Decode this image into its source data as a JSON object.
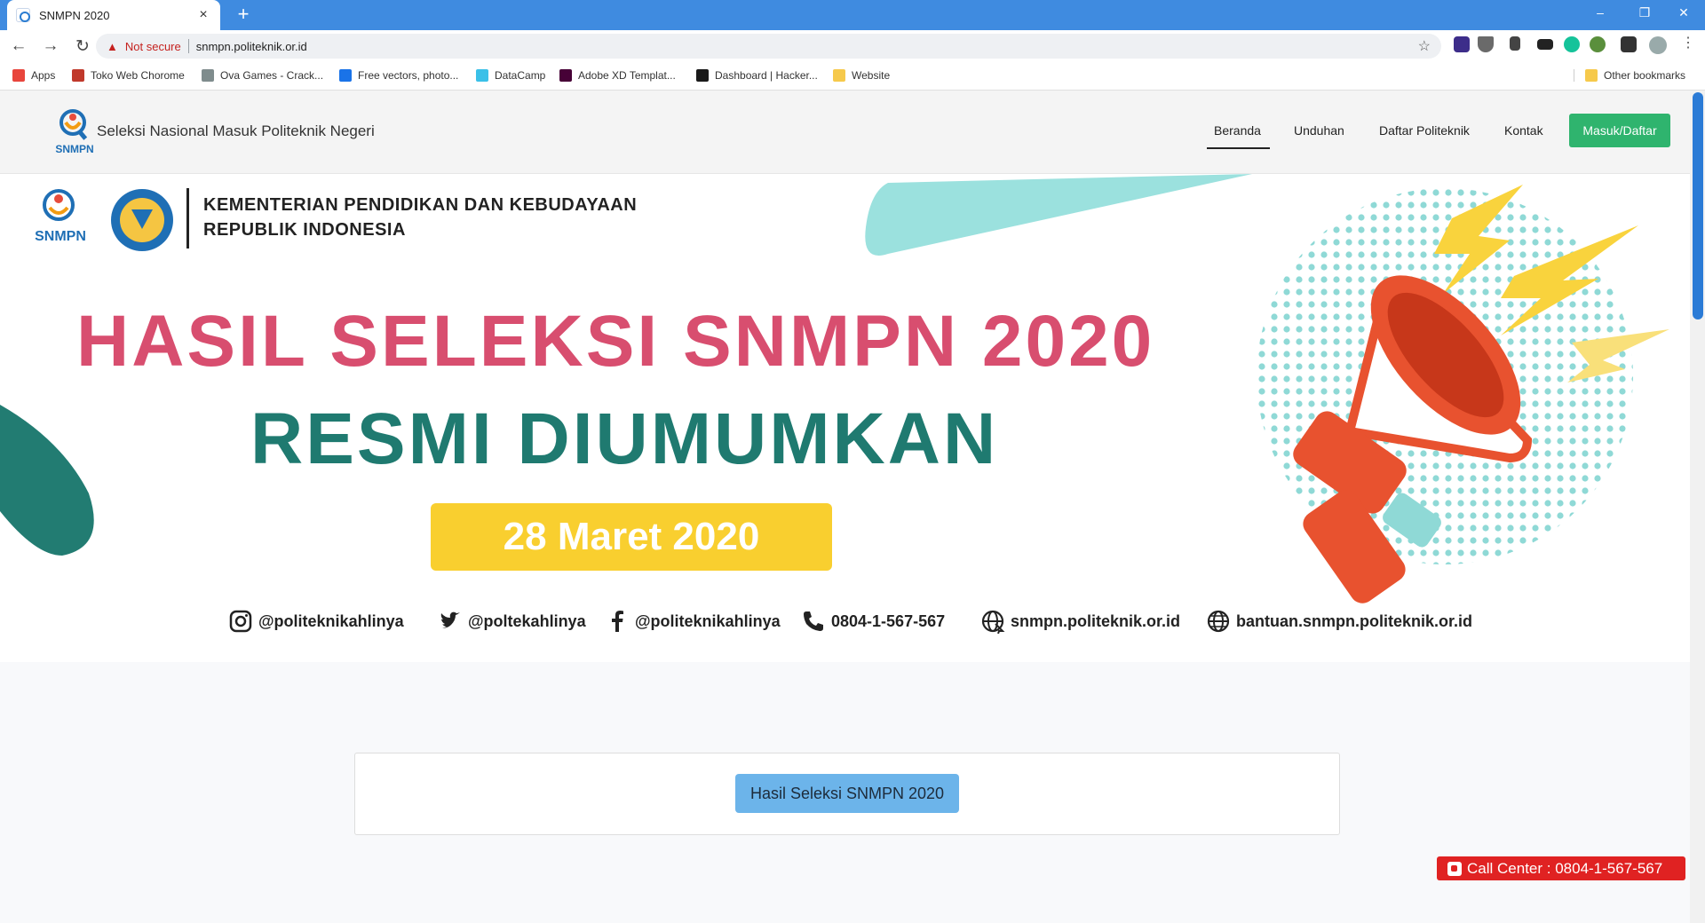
{
  "browser": {
    "tab_title": "SNMPN 2020",
    "tab_close": "×",
    "new_tab": "+",
    "window_controls": {
      "minimize": "–",
      "restore": "❐",
      "close": "✕"
    },
    "nav": {
      "back": "←",
      "forward": "→",
      "reload": "↻"
    },
    "security_label": "Not secure",
    "url": "snmpn.politeknik.or.id",
    "bookmarks": [
      {
        "label": "Apps",
        "icon": "apps-grid-icon",
        "color": "#e8453c"
      },
      {
        "label": "Toko Web Chorome",
        "icon": "webstore-icon",
        "color": "#c0392b"
      },
      {
        "label": "Ova Games - Crack...",
        "icon": "ova-games-icon",
        "color": "#7f8c8d"
      },
      {
        "label": "Free vectors, photo...",
        "icon": "freepik-icon",
        "color": "#1a73e8"
      },
      {
        "label": "DataCamp",
        "icon": "datacamp-icon",
        "color": "#3ac0e8"
      },
      {
        "label": "Adobe XD Templat...",
        "icon": "adobe-xd-icon",
        "color": "#470137"
      },
      {
        "label": "Dashboard | Hacker...",
        "icon": "hackerrank-icon",
        "color": "#1a1a1a"
      },
      {
        "label": "Website",
        "icon": "folder-icon",
        "color": "#f6c94b"
      }
    ],
    "other_bookmarks": "Other bookmarks"
  },
  "site": {
    "brand": "Seleksi Nasional Masuk Politeknik Negeri",
    "logo_text": "SNMPN",
    "menu": [
      "Beranda",
      "Unduhan",
      "Daftar Politeknik",
      "Kontak"
    ],
    "active_menu": "Beranda",
    "login_button": "Masuk/Daftar"
  },
  "banner": {
    "ministry_line1": "KEMENTERIAN PENDIDIKAN DAN KEBUDAYAAN",
    "ministry_line2": "REPUBLIK INDONESIA",
    "headline1": "HASIL SELEKSI SNMPN 2020",
    "headline2": "RESMI DIUMUMKAN",
    "date": "28 Maret 2020",
    "contacts": [
      {
        "icon": "instagram-icon",
        "text": "@politeknikahlinya"
      },
      {
        "icon": "twitter-icon",
        "text": "@poltekahlinya"
      },
      {
        "icon": "facebook-icon",
        "text": "@politeknikahlinya"
      },
      {
        "icon": "phone-icon",
        "text": "0804-1-567-567"
      },
      {
        "icon": "web-icon",
        "text": "snmpn.politeknik.or.id"
      },
      {
        "icon": "globe-icon",
        "text": "bantuan.snmpn.politeknik.or.id"
      }
    ],
    "colors": {
      "pink": "#d84e6f",
      "teal": "#1f7a70",
      "yellow": "#f9cf2f",
      "light_teal": "#8fd9d6"
    }
  },
  "card": {
    "result_button": "Hasil Seleksi SNMPN 2020"
  },
  "call_center": "Call Center : 0804-1-567-567"
}
